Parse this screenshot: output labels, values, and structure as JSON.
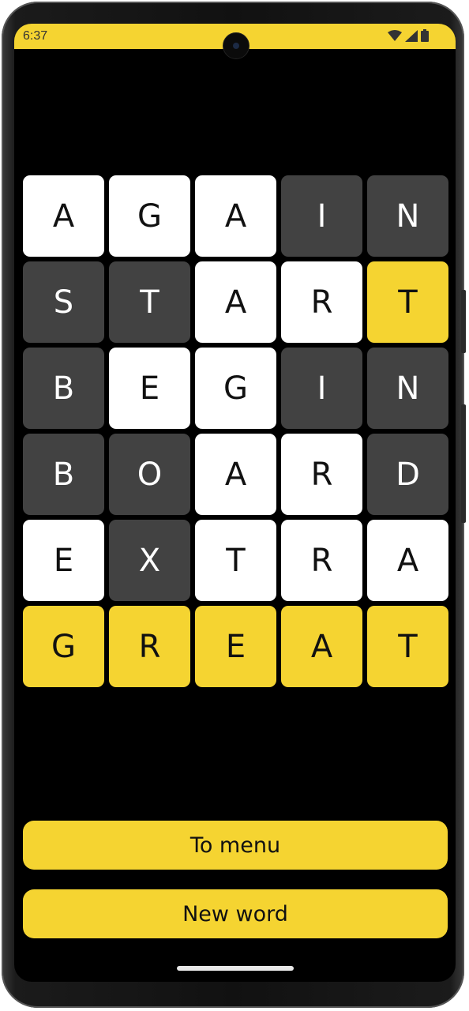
{
  "status_bar": {
    "time": "6:37",
    "icons": [
      "wifi-icon",
      "signal-icon",
      "battery-icon"
    ],
    "color": "#f5d431"
  },
  "board": {
    "rows": [
      {
        "letters": [
          "A",
          "G",
          "A",
          "I",
          "N"
        ],
        "states": [
          "white",
          "white",
          "white",
          "gray",
          "gray"
        ]
      },
      {
        "letters": [
          "S",
          "T",
          "A",
          "R",
          "T"
        ],
        "states": [
          "gray",
          "gray",
          "white",
          "white",
          "yellow"
        ]
      },
      {
        "letters": [
          "B",
          "E",
          "G",
          "I",
          "N"
        ],
        "states": [
          "gray",
          "white",
          "white",
          "gray",
          "gray"
        ]
      },
      {
        "letters": [
          "B",
          "O",
          "A",
          "R",
          "D"
        ],
        "states": [
          "gray",
          "gray",
          "white",
          "white",
          "gray"
        ]
      },
      {
        "letters": [
          "E",
          "X",
          "T",
          "R",
          "A"
        ],
        "states": [
          "white",
          "gray",
          "white",
          "white",
          "white"
        ]
      },
      {
        "letters": [
          "G",
          "R",
          "E",
          "A",
          "T"
        ],
        "states": [
          "yellow",
          "yellow",
          "yellow",
          "yellow",
          "yellow"
        ]
      }
    ],
    "colors": {
      "white": "#ffffff",
      "gray": "#424242",
      "yellow": "#f5d431"
    }
  },
  "buttons": {
    "menu_label": "To menu",
    "new_word_label": "New word"
  }
}
